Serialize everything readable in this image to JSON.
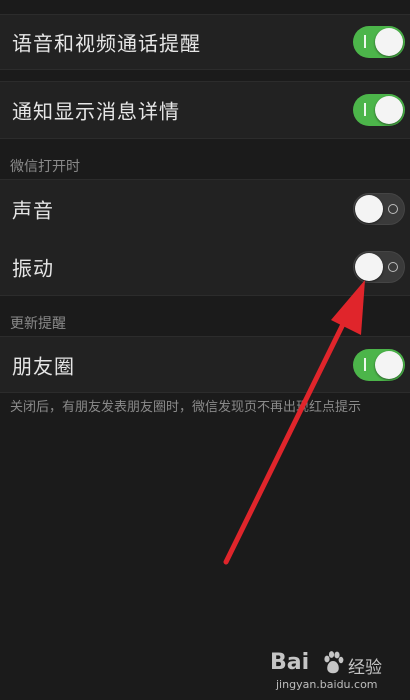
{
  "settings": {
    "voice_video_reminder": {
      "label": "语音和视频通话提醒",
      "state": "on"
    },
    "show_message_details": {
      "label": "通知显示消息详情",
      "state": "on"
    },
    "when_open_section": "微信打开时",
    "sound": {
      "label": "声音",
      "state": "off"
    },
    "vibrate": {
      "label": "振动",
      "state": "off"
    },
    "update_section": "更新提醒",
    "moments": {
      "label": "朋友圈",
      "state": "on"
    },
    "moments_footnote": "关闭后，有朋友发表朋友圈时，微信发现页不再出现红点提示"
  },
  "watermark": {
    "brand": "Bai",
    "product": "经验",
    "url": "jingyan.baidu.com"
  },
  "colors": {
    "background": "#1b1b1b",
    "row": "#222222",
    "toggle_on": "#4cb54a",
    "toggle_off": "#3a3a3a",
    "annotation_arrow": "#e0252b"
  },
  "icons": {
    "annotation": "red-arrow",
    "watermark_logo": "baidu-paw-icon"
  }
}
